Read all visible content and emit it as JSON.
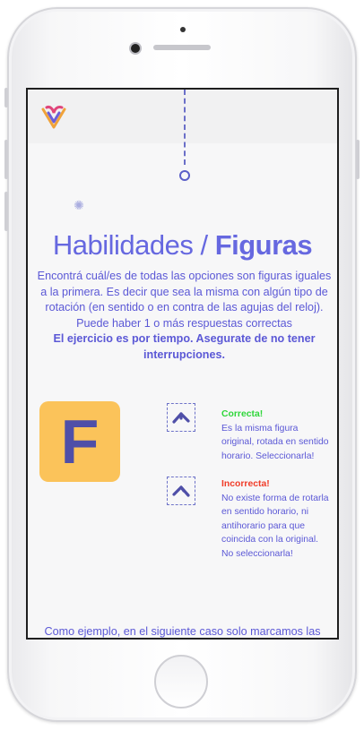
{
  "header": {
    "logo_icon": "heart-v-logo-icon"
  },
  "page": {
    "title_light": "Habilidades / ",
    "title_bold": "Figuras",
    "intro": "Encontrá cuál/es de todas las opciones son figuras iguales a la primera. Es decir que sea la misma con algún tipo de rotación (en sentido o en contra de las agujas del reloj). Puede haber 1 o más respuestas correctas",
    "intro_bold": "El ejercicio es por tiempo. Asegurate de no tener interrupciones."
  },
  "example": {
    "figure_letter": "F",
    "options": [
      {
        "label": "Correcta!",
        "text": "Es la misma figura original, rotada en sentido horario. Seleccionarla!",
        "icon": "rotated-f-shape-icon"
      },
      {
        "label": "Incorrecta!",
        "text": "No existe forma de rotarla en sentido horario, ni antihorario para que coincida con la original. No seleccionarla!",
        "icon": "rotated-f-shape-icon"
      }
    ]
  },
  "footer_text": "Como ejemplo, en el siguiente caso solo marcamos las",
  "colors": {
    "accent": "#5b58d6",
    "card": "#fbc35a",
    "correct": "#2fd63a",
    "incorrect": "#f03c28"
  }
}
